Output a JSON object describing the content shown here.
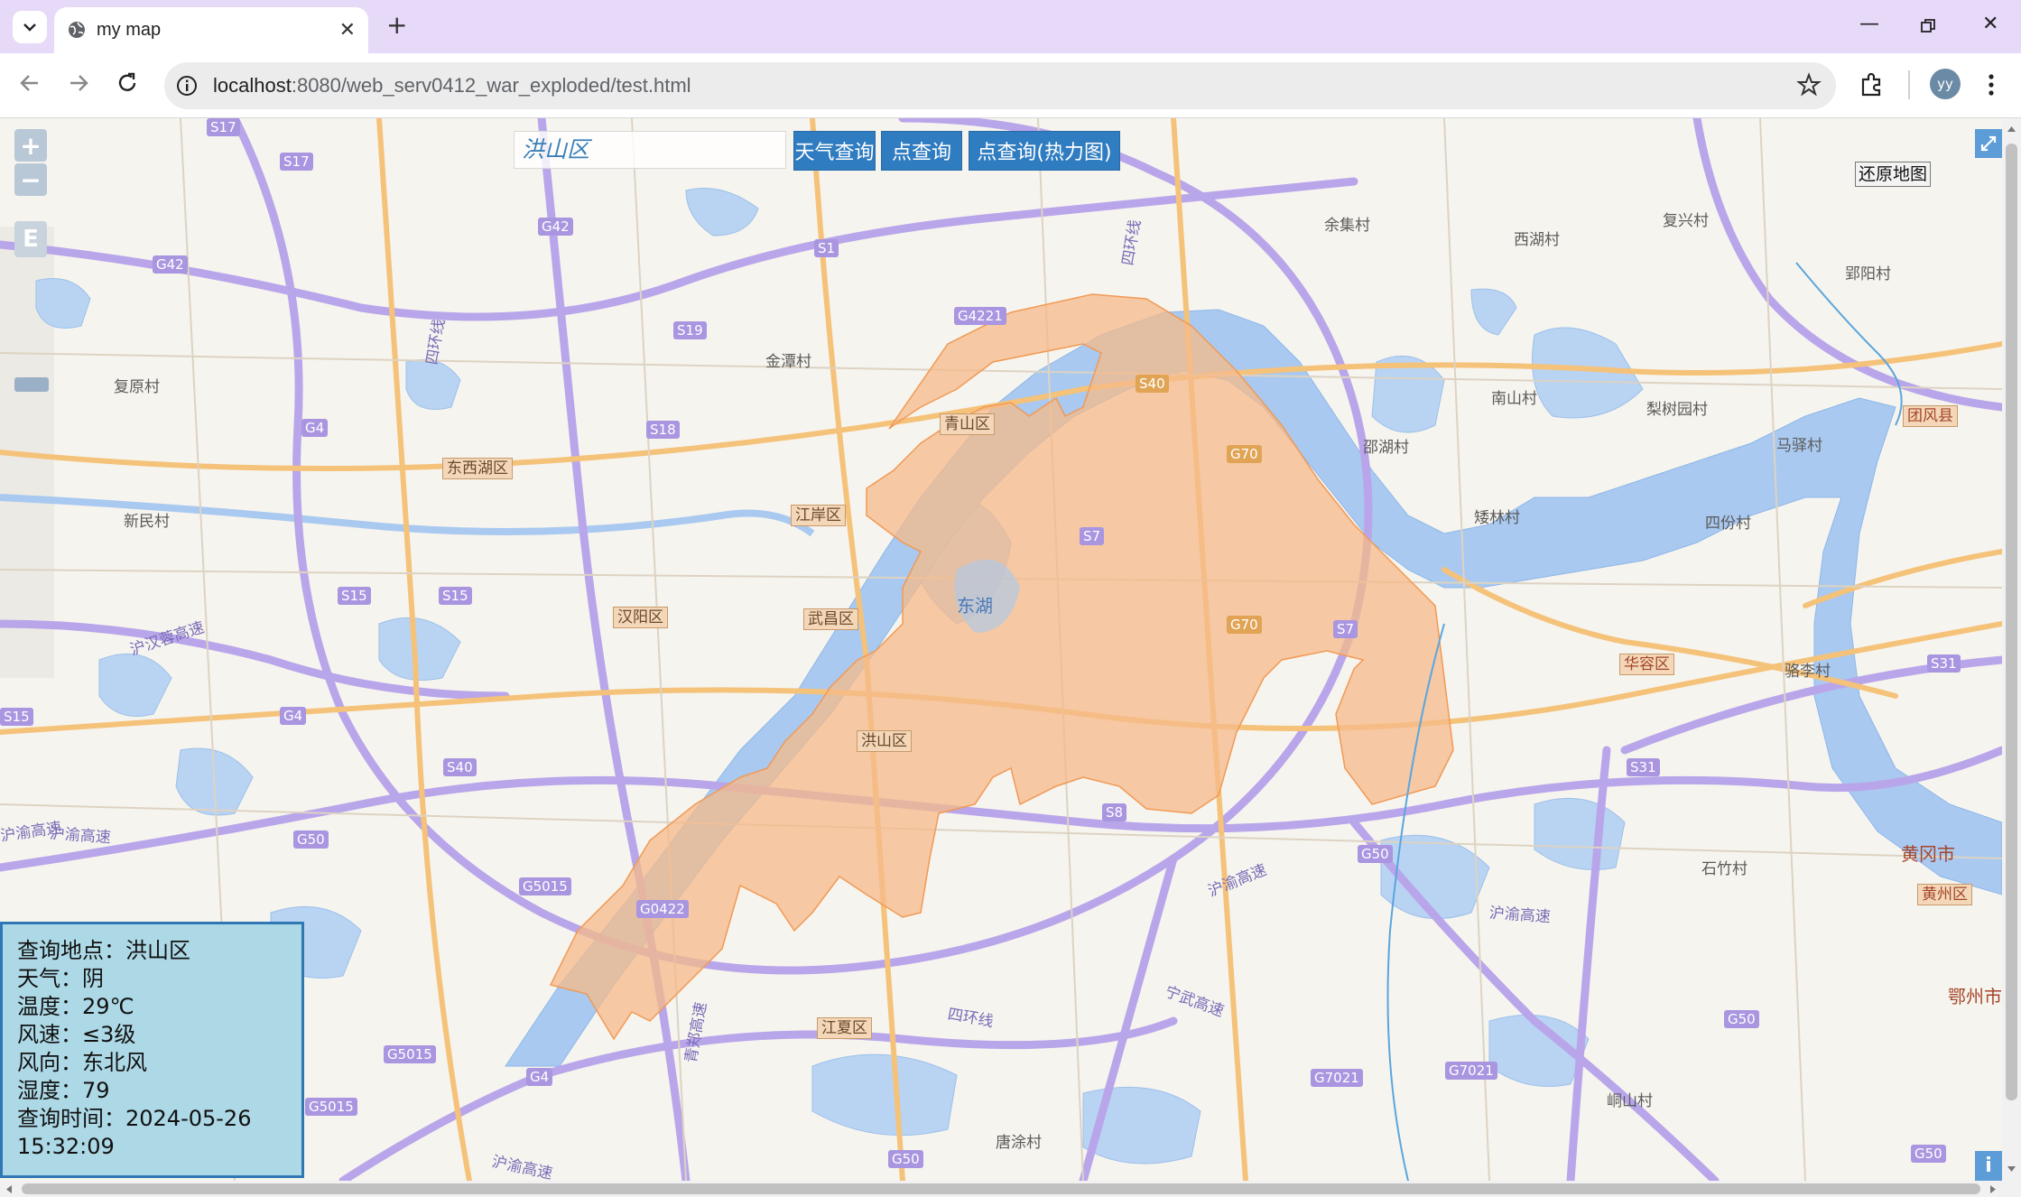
{
  "browser": {
    "tab_title": "my map",
    "url_host": "localhost",
    "url_rest": ":8080/web_serv0412_war_exploded/test.html",
    "profile_initials": "yy"
  },
  "map": {
    "search_value": "洪山区",
    "buttons": {
      "weather": "天气查询",
      "point": "点查询",
      "point_heatmap": "点查询(热力图)"
    },
    "restore_label": "还原地图",
    "zoom_in": "+",
    "zoom_out": "−",
    "extent_label": "E",
    "highlight_color": "#f5b98a",
    "labels": {
      "jinlin": "金潭村",
      "fuyuan": "复原村",
      "xinmin": "新民村",
      "yuji": "余集村",
      "xihu": "西湖村",
      "fuxing": "复兴村",
      "yiyang": "郢阳村",
      "nanshan": "南山村",
      "lishu": "梨树园村",
      "mayi": "马驿村",
      "shaohu": "邵湖村",
      "ailin": "矮林村",
      "sifen": "四份村",
      "luoli": "骆李村",
      "shizhu": "石竹村",
      "huanggang": "黄冈市",
      "ezhou": "鄂州市",
      "tanguo": "唐涂村",
      "dongshan": "峒山村",
      "lake": "东湖"
    },
    "districts": {
      "dongxihu": "东西湖区",
      "qingshan": "青山区",
      "jiangan": "江岸区",
      "hanyang": "汉阳区",
      "wuchang": "武昌区",
      "hongshan": "洪山区",
      "jiangxia": "江夏区",
      "huarong": "华容区",
      "tuanfeng": "团风县",
      "huangzhou": "黄州区"
    },
    "roads": {
      "s17a": "S17",
      "s17b": "S17",
      "g42a": "G42",
      "g42b": "G42",
      "s1": "S1",
      "s19": "S19",
      "g4221": "G4221",
      "s40a": "S40",
      "g4a": "G4",
      "s18": "S18",
      "s15a": "S15",
      "s15b": "S15",
      "s15c": "S15",
      "g4b": "G4",
      "s40b": "S40",
      "g50a": "G50",
      "g5015a": "G5015",
      "g0422": "G0422",
      "g70a": "G70",
      "s7a": "S7",
      "g70b": "G70",
      "s7b": "S7",
      "s8": "S8",
      "g50b": "G50",
      "s31a": "S31",
      "s31b": "S31",
      "g50c": "G50",
      "g7021a": "G7021",
      "g7021b": "G7021",
      "g4c": "G4",
      "g5015b": "G5015",
      "g5015c": "G5015",
      "g50d": "G50",
      "g50e": "G50"
    },
    "road_names": {
      "hurong1": "沪渝高速",
      "hurong2": "沪渝高速",
      "hurong3": "沪渝高速",
      "hurong4": "沪渝高速",
      "hurong5": "沪渝高速",
      "huhan": "沪汉蓉高速",
      "ningwu": "宁武高速",
      "sihuan1": "四环线",
      "sihuan2": "四环线",
      "sihuan3": "四环线",
      "qinghe": "青郑高速"
    }
  },
  "weather_panel": {
    "place": "查询地点：洪山区",
    "weather": "天气：阴",
    "temperature": "温度：29℃",
    "wind_speed": "风速：≤3级",
    "wind_dir": "风向：东北风",
    "humidity": "湿度：79",
    "time_line1": "查询时间：2024-05-26",
    "time_line2": "15:32:09"
  }
}
